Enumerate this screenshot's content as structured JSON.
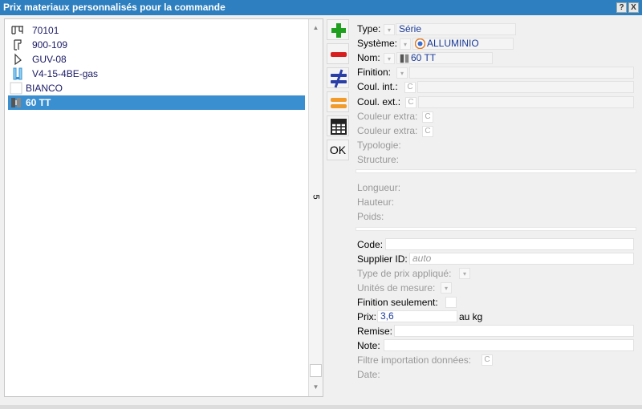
{
  "window": {
    "title": "Prix materiaux personnalisés pour la commande",
    "help_btn": "?",
    "close_btn": "X"
  },
  "list": {
    "items": [
      {
        "label": "70101",
        "icon": "profile-icon"
      },
      {
        "label": "900-109",
        "icon": "profile-icon"
      },
      {
        "label": "GUV-08",
        "icon": "gasket-icon"
      },
      {
        "label": "V4-15-4BE-gas",
        "icon": "glass-icon"
      },
      {
        "label": "BIANCO",
        "icon": "color-swatch-icon"
      },
      {
        "label": "60 TT",
        "icon": "system-icon",
        "selected": true
      }
    ],
    "count": "5"
  },
  "toolbar": {
    "add": "+",
    "remove": "−",
    "notequal": "≠",
    "equal": "=",
    "ok": "OK"
  },
  "form": {
    "type_label": "Type:",
    "type_value": "Série",
    "system_label": "Système:",
    "system_value": "ALLUMINIO",
    "name_label": "Nom:",
    "name_value": "60 TT",
    "finish_label": "Finition:",
    "col_int_label": "Coul. int.:",
    "col_ext_label": "Coul. ext.:",
    "col_extra1_label": "Couleur extra:",
    "col_extra2_label": "Couleur extra:",
    "typology_label": "Typologie:",
    "structure_label": "Structure:",
    "length_label": "Longueur:",
    "height_label": "Hauteur:",
    "weight_label": "Poids:",
    "code_label": "Code:",
    "supplier_label": "Supplier ID:",
    "supplier_placeholder": "auto",
    "price_type_label": "Type de prix appliqué:",
    "units_label": "Unités de mesure:",
    "finish_only_label": "Finition seulement:",
    "price_label": "Prix:",
    "price_value": "3,6",
    "price_unit": "au kg",
    "discount_label": "Remise:",
    "note_label": "Note:",
    "filter_label": "Filtre importation données:",
    "date_label": "Date:",
    "c_glyph": "C",
    "dd_glyph": "▾"
  }
}
